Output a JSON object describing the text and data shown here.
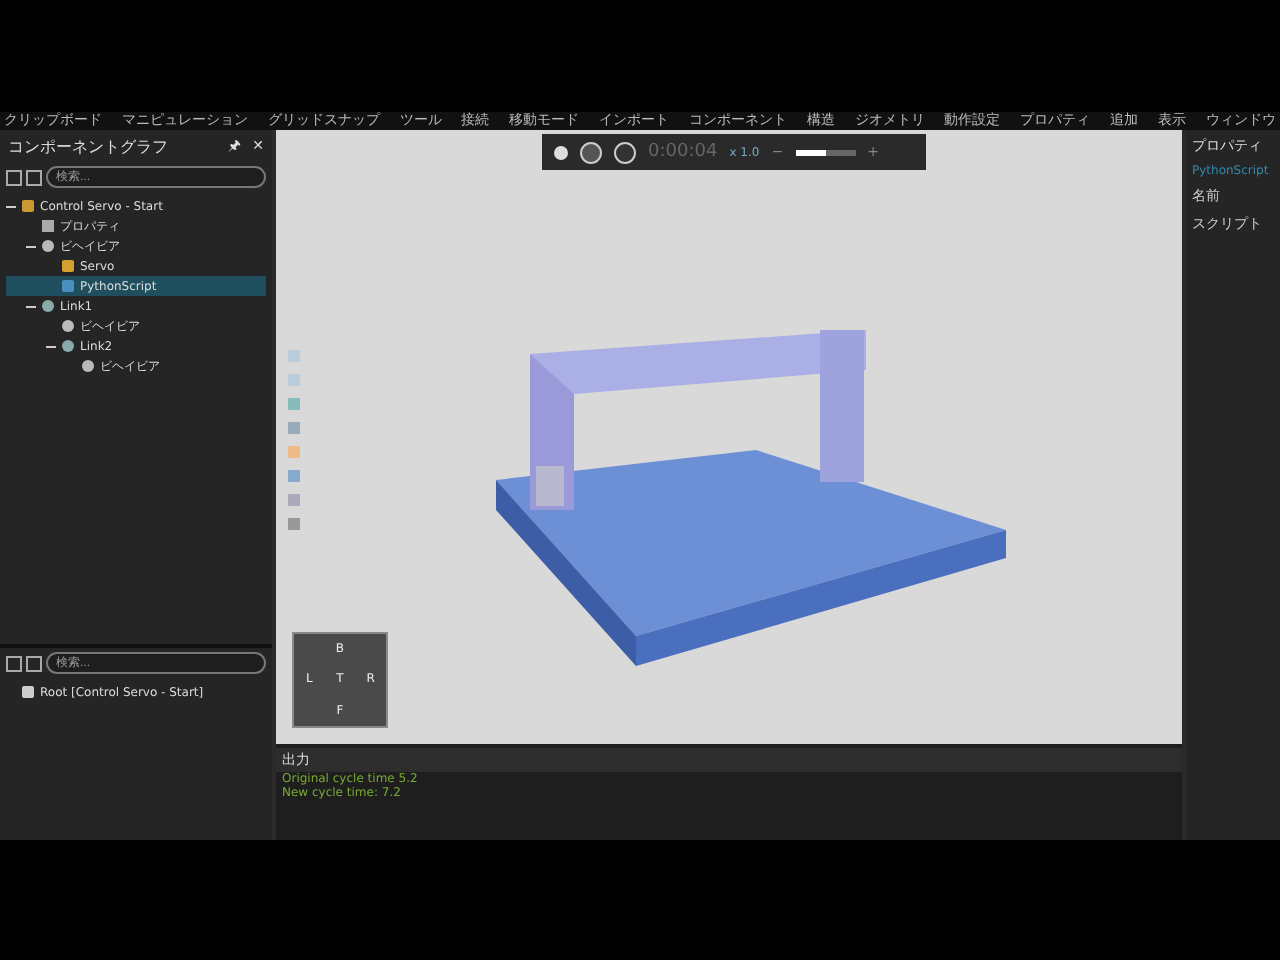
{
  "menu": [
    "クリップボード",
    "マニピュレーション",
    "グリッドスナップ",
    "ツール",
    "接続",
    "移動モード",
    "インポート",
    "コンポーネント",
    "構造",
    "ジオメトリ",
    "動作設定",
    "プロパティ",
    "追加",
    "表示",
    "ウィンドウ"
  ],
  "component_graph": {
    "title": "コンポーネントグラフ",
    "pin": "🖈",
    "close": "✕",
    "search": {
      "placeholder": "検索..."
    },
    "tree": [
      {
        "label": "Control Servo - Start",
        "kind": "component",
        "expanded": true,
        "selected": false,
        "children": [
          {
            "label": "プロパティ",
            "kind": "properties",
            "selected": false
          },
          {
            "label": "ビヘイビア",
            "kind": "behavior",
            "expanded": true,
            "selected": false,
            "children": [
              {
                "label": "Servo",
                "kind": "servo",
                "selected": false
              },
              {
                "label": "PythonScript",
                "kind": "script",
                "selected": true
              }
            ]
          },
          {
            "label": "Link1",
            "kind": "link",
            "expanded": true,
            "selected": false,
            "children": [
              {
                "label": "ビヘイビア",
                "kind": "behavior",
                "selected": false
              },
              {
                "label": "Link2",
                "kind": "link",
                "expanded": true,
                "selected": false,
                "children": [
                  {
                    "label": "ビヘイビア",
                    "kind": "behavior",
                    "selected": false
                  }
                ]
              }
            ]
          }
        ]
      }
    ]
  },
  "lower_panel": {
    "search": {
      "placeholder": "検索..."
    },
    "tree": [
      {
        "label": "Root [Control Servo - Start]",
        "kind": "root",
        "selected": false
      }
    ]
  },
  "playback": {
    "time": "0:00:04",
    "speed": "x 1.0",
    "minus": "−",
    "plus": "+",
    "level": 0.5
  },
  "view_cube": {
    "top": "B",
    "left": "L",
    "center": "T",
    "right": "R",
    "bottom": "F"
  },
  "output": {
    "title": "出力",
    "lines": [
      "Original cycle time 5.2",
      "New cycle time:  7.2"
    ]
  },
  "properties": {
    "title": "プロパティ",
    "name": "PythonScript",
    "fields": [
      "名前",
      "スクリプト"
    ]
  }
}
